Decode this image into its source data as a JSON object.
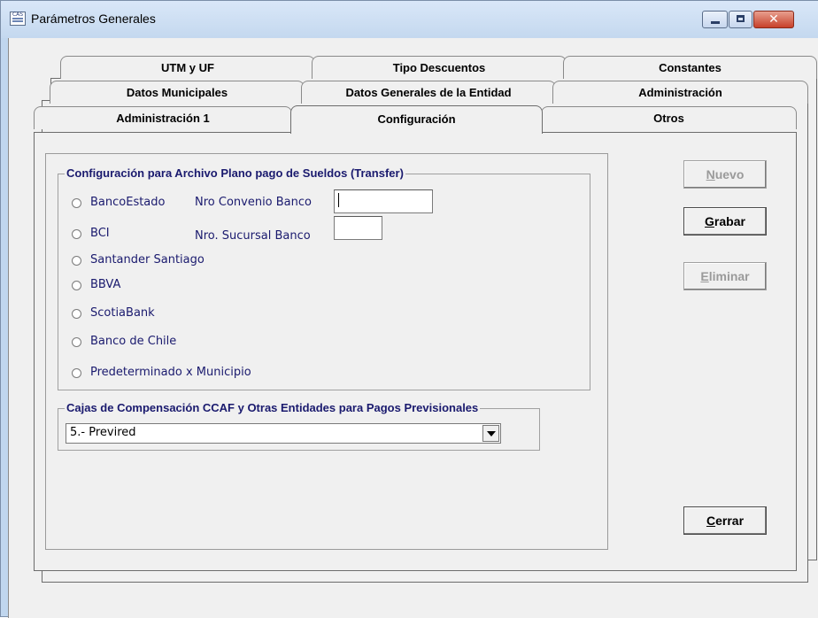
{
  "window": {
    "title": "Parámetros Generales",
    "icon": "cas-icon"
  },
  "tabs": {
    "row1": [
      {
        "label": "UTM y UF"
      },
      {
        "label": "Tipo Descuentos"
      },
      {
        "label": "Constantes"
      }
    ],
    "row2": [
      {
        "label": "Datos Municipales"
      },
      {
        "label": "Datos Generales de la Entidad"
      },
      {
        "label": "Administración"
      }
    ],
    "row3": [
      {
        "label": "Administración 1"
      },
      {
        "label": "Configuración",
        "active": true
      },
      {
        "label": "Otros"
      }
    ]
  },
  "transfer_group": {
    "legend": "Configuración para Archivo Plano pago de Sueldos (Transfer)",
    "banks": [
      {
        "label": "BancoEstado"
      },
      {
        "label": "BCI"
      },
      {
        "label": "Santander Santiago"
      },
      {
        "label": "BBVA"
      },
      {
        "label": "ScotiaBank"
      },
      {
        "label": "Banco de Chile"
      },
      {
        "label": "Predeterminado x Municipio"
      }
    ],
    "convenio_label": "Nro Convenio Banco",
    "convenio_value": "",
    "sucursal_label": "Nro. Sucursal  Banco",
    "sucursal_value": ""
  },
  "ccaf_group": {
    "legend": "Cajas de Compensación CCAF y Otras Entidades para Pagos Previsionales",
    "selected": "5.- Previred"
  },
  "buttons": {
    "nuevo": {
      "first": "N",
      "rest": "uevo",
      "enabled": false
    },
    "grabar": {
      "first": "G",
      "rest": "rabar",
      "enabled": true
    },
    "eliminar": {
      "first": "E",
      "rest": "liminar",
      "enabled": false
    },
    "cerrar": {
      "first": "C",
      "rest": "errar",
      "enabled": true
    }
  }
}
